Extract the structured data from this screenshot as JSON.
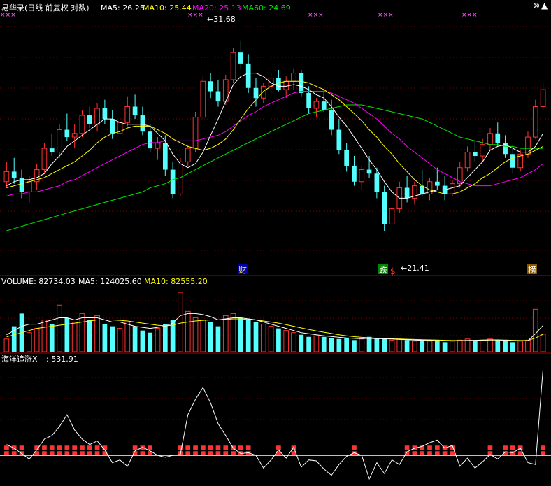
{
  "header": {
    "title": "易华录(日线 前复权 对数)",
    "ma5": "MA5: 26.25",
    "ma10": "MA10: 25.44",
    "ma20": "MA20: 25.13",
    "ma60": "MA60: 24.69"
  },
  "volume_header": {
    "volume": "VOLUME: 82734.03",
    "ma5": "MA5: 124025.60",
    "ma10": "MA10: 82555.20"
  },
  "indicator_header": {
    "name": "海洋追涨X",
    "value": ": 531.91"
  },
  "price_panel": {
    "high_label": "31.68",
    "low_label": "21.41",
    "markers": [
      {
        "text": "财",
        "color": "#ffff00",
        "bg": "#0000aa"
      },
      {
        "text": "跌",
        "color": "#ffffff",
        "bg": "#008800"
      },
      {
        "text": "$",
        "color": "#ff3030",
        "bg": ""
      },
      {
        "text": "榜",
        "color": "#ffffff",
        "bg": "#885500"
      }
    ],
    "top_marks": "×××"
  },
  "colors": {
    "up": "#ff3232",
    "down": "#54ffff",
    "ma5": "#ffffff",
    "ma10": "#ffff00",
    "ma20": "#ff00ff",
    "ma60": "#00e600",
    "grid": "#800000",
    "indicator_bar": "#ff3232"
  },
  "chart_data": {
    "type": "candlestick",
    "title": "易华录(日线 前复权 对数)",
    "price_range": [
      19.8,
      33.2
    ],
    "series_price": [
      [
        23.6,
        24.6,
        23.3,
        24.1
      ],
      [
        24.1,
        24.8,
        23.5,
        23.8
      ],
      [
        23.8,
        24.2,
        22.8,
        23.1
      ],
      [
        23.1,
        23.9,
        22.6,
        23.6
      ],
      [
        23.6,
        24.5,
        23.2,
        24.2
      ],
      [
        24.2,
        25.6,
        24.0,
        25.3
      ],
      [
        25.3,
        26.1,
        24.9,
        25.1
      ],
      [
        25.1,
        26.6,
        24.8,
        26.3
      ],
      [
        26.3,
        27.2,
        25.7,
        25.9
      ],
      [
        25.9,
        26.6,
        25.3,
        26.1
      ],
      [
        26.1,
        27.4,
        25.9,
        27.1
      ],
      [
        27.1,
        27.6,
        26.4,
        26.6
      ],
      [
        26.6,
        27.8,
        26.2,
        27.5
      ],
      [
        27.5,
        28.0,
        26.6,
        26.9
      ],
      [
        26.9,
        27.4,
        25.8,
        26.1
      ],
      [
        26.1,
        27.0,
        25.9,
        26.7
      ],
      [
        26.7,
        28.2,
        26.5,
        27.6
      ],
      [
        27.6,
        28.3,
        26.9,
        27.1
      ],
      [
        27.1,
        27.6,
        26.0,
        26.2
      ],
      [
        26.2,
        26.6,
        25.1,
        25.3
      ],
      [
        25.3,
        25.9,
        24.7,
        25.6
      ],
      [
        25.6,
        26.0,
        23.9,
        24.2
      ],
      [
        24.2,
        24.6,
        22.8,
        23.0
      ],
      [
        23.0,
        24.8,
        22.9,
        24.6
      ],
      [
        24.6,
        25.5,
        24.4,
        25.3
      ],
      [
        25.3,
        27.3,
        25.1,
        27.0
      ],
      [
        27.0,
        29.4,
        26.8,
        29.1
      ],
      [
        29.1,
        29.6,
        28.1,
        28.5
      ],
      [
        28.5,
        29.2,
        27.6,
        27.9
      ],
      [
        27.9,
        29.5,
        27.7,
        29.2
      ],
      [
        29.2,
        31.2,
        29.0,
        30.9
      ],
      [
        30.9,
        31.7,
        29.9,
        30.2
      ],
      [
        30.2,
        30.8,
        28.4,
        28.7
      ],
      [
        28.7,
        29.3,
        27.6,
        28.1
      ],
      [
        28.1,
        29.0,
        27.8,
        28.8
      ],
      [
        28.8,
        29.6,
        28.3,
        29.3
      ],
      [
        29.3,
        29.8,
        28.5,
        28.6
      ],
      [
        28.6,
        29.4,
        28.1,
        29.1
      ],
      [
        29.1,
        29.9,
        28.6,
        29.6
      ],
      [
        29.6,
        29.8,
        28.2,
        28.4
      ],
      [
        28.4,
        28.8,
        27.2,
        27.5
      ],
      [
        27.5,
        28.1,
        27.0,
        27.9
      ],
      [
        27.9,
        28.6,
        27.3,
        27.4
      ],
      [
        27.4,
        28.0,
        26.0,
        26.3
      ],
      [
        26.3,
        26.9,
        25.0,
        25.2
      ],
      [
        25.2,
        25.6,
        24.1,
        24.4
      ],
      [
        24.4,
        24.9,
        23.4,
        23.6
      ],
      [
        23.6,
        24.4,
        23.2,
        24.2
      ],
      [
        24.2,
        24.9,
        23.8,
        24.0
      ],
      [
        24.0,
        24.3,
        22.8,
        23.1
      ],
      [
        23.1,
        23.4,
        21.3,
        21.6
      ],
      [
        21.6,
        22.6,
        21.4,
        22.3
      ],
      [
        22.3,
        23.6,
        22.1,
        23.3
      ],
      [
        23.3,
        23.9,
        22.6,
        22.8
      ],
      [
        22.8,
        23.6,
        22.5,
        23.4
      ],
      [
        23.4,
        24.2,
        22.9,
        23.0
      ],
      [
        23.0,
        23.8,
        22.7,
        23.6
      ],
      [
        23.6,
        24.3,
        23.2,
        23.4
      ],
      [
        23.4,
        23.9,
        22.7,
        23.0
      ],
      [
        23.0,
        23.7,
        22.9,
        23.5
      ],
      [
        23.5,
        24.6,
        23.3,
        24.3
      ],
      [
        24.3,
        25.4,
        24.1,
        25.1
      ],
      [
        25.1,
        25.7,
        24.6,
        24.9
      ],
      [
        24.9,
        25.8,
        24.6,
        25.5
      ],
      [
        25.5,
        26.4,
        25.2,
        26.1
      ],
      [
        26.1,
        26.7,
        25.4,
        25.6
      ],
      [
        25.6,
        26.0,
        24.8,
        25.0
      ],
      [
        25.0,
        25.5,
        24.0,
        24.3
      ],
      [
        24.3,
        25.2,
        24.1,
        25.0
      ],
      [
        25.0,
        26.2,
        24.8,
        25.9
      ],
      [
        25.9,
        28.0,
        25.8,
        27.6
      ],
      [
        27.6,
        29.0,
        27.4,
        28.6
      ]
    ],
    "series_ma5": [
      23.4,
      23.6,
      23.7,
      23.7,
      23.8,
      24.0,
      24.5,
      24.9,
      25.4,
      25.7,
      26.0,
      26.3,
      26.6,
      26.9,
      26.9,
      26.7,
      26.6,
      26.6,
      26.6,
      26.5,
      26.1,
      25.7,
      25.0,
      24.5,
      24.3,
      24.5,
      25.1,
      26.0,
      26.9,
      27.9,
      28.9,
      29.4,
      29.6,
      29.6,
      29.4,
      29.0,
      28.8,
      28.8,
      28.9,
      28.8,
      28.6,
      28.3,
      28.1,
      27.6,
      27.0,
      26.5,
      25.9,
      25.3,
      24.7,
      24.2,
      23.6,
      23.1,
      22.8,
      22.8,
      22.9,
      23.0,
      23.1,
      23.2,
      23.2,
      23.3,
      23.4,
      23.8,
      24.2,
      24.6,
      25.2,
      25.4,
      25.5,
      25.3,
      25.1,
      25.1,
      25.4,
      26.1
    ],
    "series_ma10": [
      23.3,
      23.4,
      23.5,
      23.6,
      23.7,
      23.8,
      24.0,
      24.2,
      24.4,
      24.6,
      24.9,
      25.2,
      25.6,
      25.9,
      26.1,
      26.2,
      26.4,
      26.5,
      26.5,
      26.5,
      26.3,
      26.1,
      25.8,
      25.6,
      25.4,
      25.3,
      25.2,
      25.3,
      25.5,
      25.8,
      26.3,
      26.9,
      27.5,
      28.0,
      28.5,
      28.8,
      29.0,
      29.1,
      29.1,
      29.1,
      29.0,
      28.8,
      28.6,
      28.3,
      28.0,
      27.6,
      27.2,
      26.8,
      26.3,
      25.9,
      25.4,
      25.0,
      24.5,
      24.1,
      23.7,
      23.4,
      23.2,
      23.1,
      23.0,
      23.0,
      23.1,
      23.3,
      23.5,
      23.8,
      24.0,
      24.3,
      24.6,
      24.8,
      24.9,
      25.0,
      25.2,
      25.4
    ],
    "series_ma20": [
      22.9,
      23.0,
      23.0,
      23.1,
      23.1,
      23.2,
      23.3,
      23.4,
      23.6,
      23.7,
      23.9,
      24.1,
      24.3,
      24.5,
      24.7,
      24.9,
      25.1,
      25.3,
      25.5,
      25.6,
      25.6,
      25.7,
      25.7,
      25.7,
      25.7,
      25.7,
      25.8,
      25.9,
      26.0,
      26.2,
      26.5,
      26.8,
      27.1,
      27.3,
      27.6,
      27.8,
      28.0,
      28.2,
      28.4,
      28.5,
      28.5,
      28.5,
      28.5,
      28.4,
      28.2,
      28.0,
      27.8,
      27.5,
      27.2,
      26.9,
      26.5,
      26.1,
      25.8,
      25.4,
      25.1,
      24.8,
      24.5,
      24.2,
      24.0,
      23.8,
      23.6,
      23.5,
      23.4,
      23.4,
      23.4,
      23.5,
      23.6,
      23.7,
      23.8,
      24.0,
      24.2,
      24.5
    ],
    "series_ma60": [
      21.3,
      21.4,
      21.5,
      21.6,
      21.7,
      21.8,
      21.9,
      22.0,
      22.1,
      22.2,
      22.3,
      22.4,
      22.5,
      22.6,
      22.7,
      22.8,
      22.9,
      23.0,
      23.1,
      23.3,
      23.4,
      23.5,
      23.7,
      23.8,
      24.0,
      24.2,
      24.4,
      24.6,
      24.8,
      25.0,
      25.2,
      25.4,
      25.6,
      25.8,
      26.0,
      26.2,
      26.4,
      26.6,
      26.8,
      27.0,
      27.2,
      27.3,
      27.4,
      27.5,
      27.6,
      27.7,
      27.7,
      27.7,
      27.6,
      27.5,
      27.4,
      27.3,
      27.2,
      27.1,
      27.0,
      26.9,
      26.7,
      26.5,
      26.3,
      26.1,
      25.9,
      25.8,
      25.7,
      25.6,
      25.5,
      25.5,
      25.4,
      25.4,
      25.3,
      25.3,
      25.3,
      25.3
    ],
    "volume_range": [
      0,
      300000
    ],
    "series_volume": [
      60000,
      120000,
      180000,
      90000,
      110000,
      150000,
      130000,
      220000,
      160000,
      140000,
      180000,
      150000,
      170000,
      130000,
      120000,
      110000,
      140000,
      120000,
      100000,
      90000,
      110000,
      130000,
      150000,
      280000,
      190000,
      160000,
      150000,
      140000,
      120000,
      170000,
      180000,
      160000,
      150000,
      140000,
      130000,
      120000,
      110000,
      100000,
      90000,
      80000,
      70000,
      75000,
      70000,
      65000,
      60000,
      65000,
      55000,
      60000,
      70000,
      65000,
      60000,
      55000,
      60000,
      55000,
      50000,
      55000,
      50000,
      55000,
      45000,
      50000,
      55000,
      60000,
      50000,
      55000,
      60000,
      55000,
      50000,
      45000,
      50000,
      55000,
      200000,
      82734
    ],
    "series_volume_ma5": [
      80000,
      100000,
      120000,
      130000,
      130000,
      140000,
      150000,
      160000,
      160000,
      150000,
      160000,
      160000,
      160000,
      150000,
      140000,
      140000,
      130000,
      120000,
      115000,
      110000,
      115000,
      120000,
      135000,
      170000,
      180000,
      180000,
      175000,
      165000,
      150000,
      155000,
      160000,
      160000,
      155000,
      150000,
      140000,
      130000,
      120000,
      110000,
      100000,
      90000,
      85000,
      80000,
      75000,
      72000,
      68000,
      65000,
      63000,
      62000,
      63000,
      62000,
      61000,
      60000,
      58000,
      57000,
      55000,
      54000,
      53000,
      52000,
      51000,
      51000,
      52000,
      53000,
      54000,
      55000,
      56000,
      56000,
      54000,
      52000,
      51000,
      52000,
      85000,
      124025
    ],
    "series_volume_ma10": [
      70000,
      80000,
      90000,
      100000,
      110000,
      115000,
      120000,
      125000,
      130000,
      135000,
      140000,
      145000,
      150000,
      150000,
      150000,
      148000,
      145000,
      140000,
      135000,
      130000,
      125000,
      122000,
      125000,
      135000,
      140000,
      145000,
      148000,
      150000,
      150000,
      152000,
      155000,
      155000,
      152000,
      150000,
      145000,
      140000,
      135000,
      128000,
      120000,
      112000,
      105000,
      98000,
      92000,
      86000,
      80000,
      75000,
      71000,
      68000,
      66000,
      64000,
      62000,
      61000,
      60000,
      59000,
      58000,
      57000,
      56000,
      55000,
      54000,
      53000,
      53000,
      53000,
      53000,
      54000,
      55000,
      55000,
      55000,
      54000,
      53000,
      53000,
      65000,
      82555
    ],
    "indicator_range": [
      -30,
      100
    ],
    "series_indicator": [
      12,
      8,
      2,
      -4,
      6,
      18,
      22,
      32,
      45,
      28,
      18,
      12,
      16,
      6,
      -8,
      -5,
      -12,
      5,
      9,
      5,
      0,
      -2,
      0,
      1,
      45,
      62,
      75,
      58,
      35,
      22,
      8,
      2,
      3,
      0,
      -14,
      -5,
      6,
      -3,
      9,
      -13,
      -5,
      -6,
      -15,
      -22,
      -10,
      -1,
      3,
      0,
      -26,
      -8,
      -20,
      -5,
      -10,
      4,
      8,
      10,
      14,
      17,
      8,
      11,
      -12,
      -3,
      -14,
      -7,
      1,
      -4,
      4,
      3,
      8,
      -8,
      -10,
      96
    ]
  }
}
